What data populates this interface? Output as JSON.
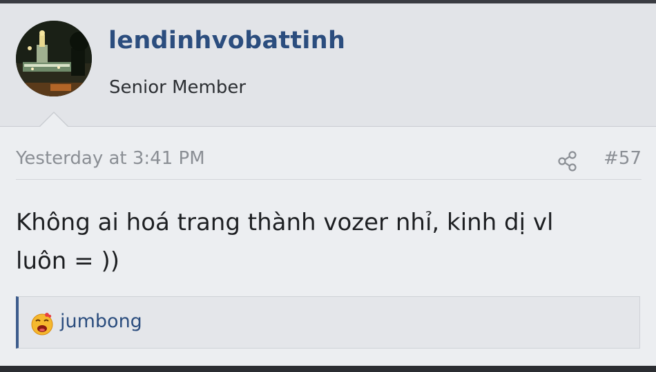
{
  "post": {
    "author": {
      "username": "lendinhvobattinh",
      "title": "Senior Member"
    },
    "meta": {
      "timestamp": "Yesterday at 3:41 PM",
      "post_number": "#57"
    },
    "content": {
      "line1": "Không ai hoá trang thành vozer nhỉ, kinh dị vl",
      "line2": "luôn = ))"
    },
    "reactions": {
      "user": "jumbong",
      "icon": "haha-emoji-icon"
    }
  },
  "colors": {
    "username": "#2b4d7e",
    "header_bg": "#e2e4e8",
    "body_bg": "#eceef1",
    "meta_text": "#8a8e94",
    "reaction_border": "#3d5c8c"
  }
}
